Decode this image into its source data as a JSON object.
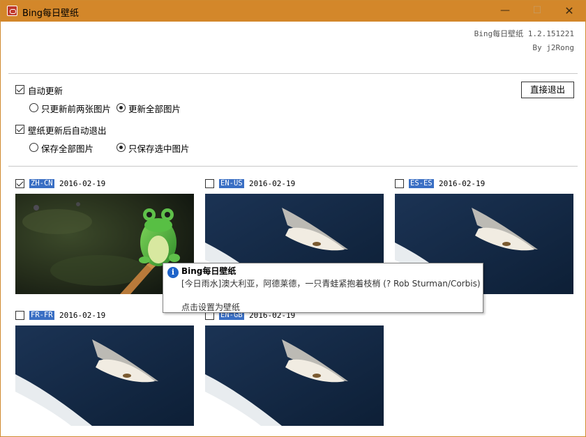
{
  "window": {
    "title": "Bing每日壁纸",
    "minimize": "—",
    "maximize": "☐",
    "close": "✕",
    "accent_color": "#d3872a"
  },
  "about": {
    "version": "Bing每日壁纸 1.2.151221",
    "author": "By j2Rong"
  },
  "settings": {
    "auto_update_label": "自动更新",
    "auto_update_checked": true,
    "update_first_two_label": "只更新前两张图片",
    "update_all_label": "更新全部图片",
    "update_mode_selected": "update_all",
    "auto_exit_label": "壁纸更新后自动退出",
    "auto_exit_checked": true,
    "save_all_label": "保存全部图片",
    "save_selected_label": "只保存选中图片",
    "save_mode_selected": "save_selected",
    "exit_button_label": "直接退出"
  },
  "wallpapers": [
    {
      "region": "ZH-CN",
      "date": "2016-02-19",
      "checked": true,
      "image": "frog-on-branch"
    },
    {
      "region": "EN-US",
      "date": "2016-02-19",
      "checked": false,
      "image": "feather-on-water"
    },
    {
      "region": "ES-ES",
      "date": "2016-02-19",
      "checked": false,
      "image": "feather-on-water"
    },
    {
      "region": "FR-FR",
      "date": "2016-02-19",
      "checked": false,
      "image": "feather-on-water"
    },
    {
      "region": "EN-GB",
      "date": "2016-02-19",
      "checked": false,
      "image": "feather-on-water"
    }
  ],
  "tooltip": {
    "icon": "info-icon",
    "title": "Bing每日壁纸",
    "body": "[今日雨水]澳大利亚，阿德莱德，一只青蛙紧抱着枝梢 (? Rob Sturman/Corbis)",
    "hint": "点击设置为壁纸"
  }
}
